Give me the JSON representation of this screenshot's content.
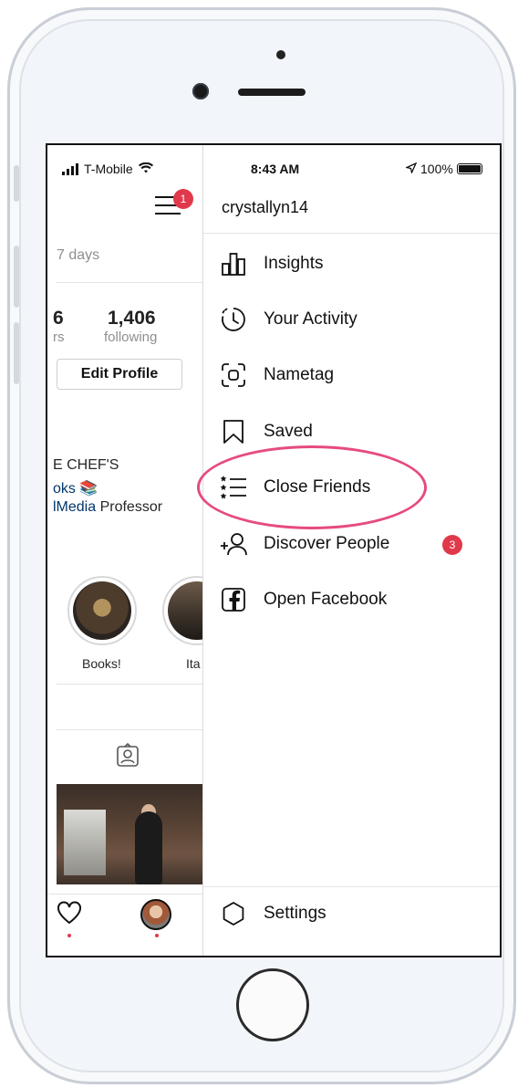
{
  "status_bar": {
    "carrier": "T-Mobile",
    "time": "8:43 AM",
    "battery": "100%"
  },
  "profile": {
    "notification_count": "1",
    "insights_period": "7 days",
    "followers_count_fragment": "6",
    "followers_label_fragment": "rs",
    "following_count": "1,406",
    "following_label": "following",
    "edit_profile_label": "Edit Profile",
    "bio_line1": "E CHEF'S",
    "bio_line2": "oks 📚",
    "bio_line3_link": "lMedia",
    "bio_line3_text": " Professor",
    "highlights": [
      {
        "label": "Books!"
      },
      {
        "label": "Ita"
      }
    ]
  },
  "drawer": {
    "username": "crystallyn14",
    "items": [
      {
        "label": "Insights",
        "icon": "bar-chart-icon"
      },
      {
        "label": "Your Activity",
        "icon": "activity-clock-icon"
      },
      {
        "label": "Nametag",
        "icon": "nametag-scan-icon"
      },
      {
        "label": "Saved",
        "icon": "bookmark-icon"
      },
      {
        "label": "Close Friends",
        "icon": "close-friends-list-icon"
      },
      {
        "label": "Discover People",
        "icon": "add-person-icon",
        "badge": "3"
      },
      {
        "label": "Open Facebook",
        "icon": "facebook-icon"
      }
    ],
    "settings_label": "Settings"
  },
  "colors": {
    "badge": "#e0394b",
    "highlight_ellipse": "#e64b7f",
    "link": "#00376b",
    "secondary_text": "#8e8e8e"
  }
}
